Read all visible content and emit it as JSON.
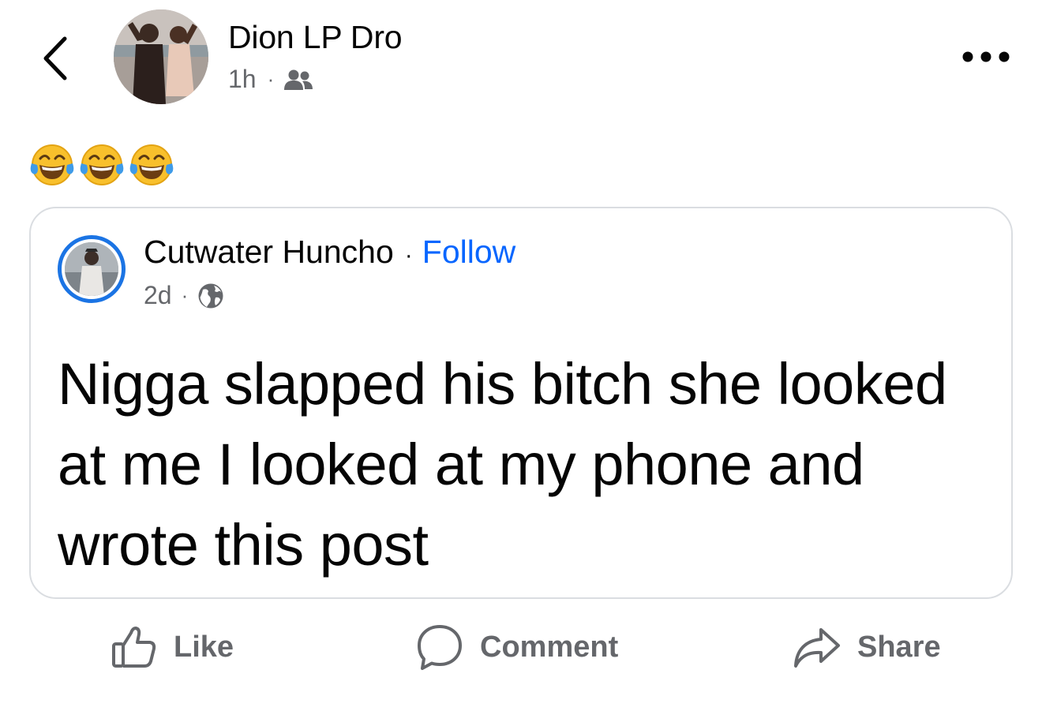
{
  "post": {
    "author": "Dion LP Dro",
    "time": "1h",
    "separator": "·",
    "audience_icon": "friends-icon",
    "body_emojis": [
      "face-with-tears-of-joy",
      "face-with-tears-of-joy",
      "face-with-tears-of-joy"
    ],
    "more_icon": "more-horizontal-icon"
  },
  "shared": {
    "author": "Cutwater Huncho",
    "separator": "·",
    "follow": "Follow",
    "time": "2d",
    "audience_icon": "globe-icon",
    "text": "Nigga slapped his bitch she looked at me I looked at my phone and wrote this post"
  },
  "actions": {
    "like": "Like",
    "comment": "Comment",
    "share": "Share"
  },
  "colors": {
    "accent": "#0866ff",
    "story_ring": "#1b74e4",
    "muted_text": "#65676b",
    "card_border": "#dadde1"
  }
}
